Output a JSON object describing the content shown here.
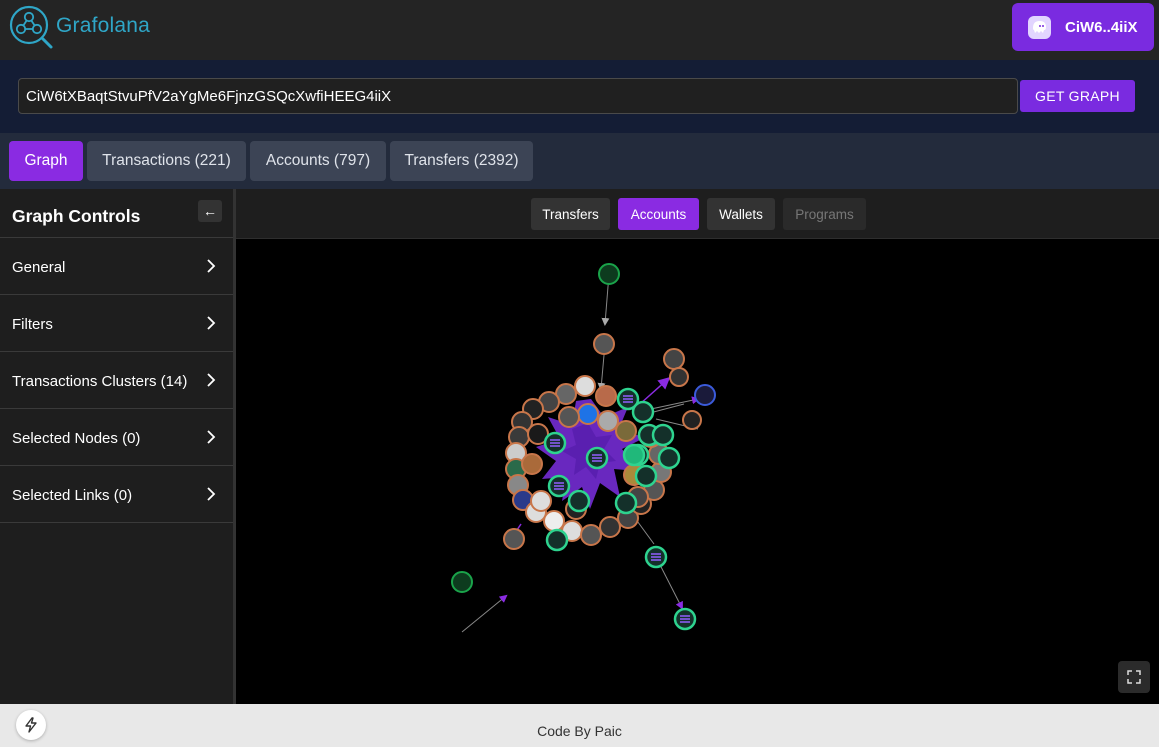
{
  "app": {
    "name": "Grafolana"
  },
  "wallet": {
    "label": "CiW6..4iiX"
  },
  "search": {
    "value": "CiW6tXBaqtStvuPfV2aYgMe6FjnzGSQcXwfiHEEG4iiX",
    "button_label": "GET GRAPH"
  },
  "tabs": [
    {
      "label": "Graph",
      "active": true
    },
    {
      "label": "Transactions (221)",
      "active": false
    },
    {
      "label": "Accounts (797)",
      "active": false
    },
    {
      "label": "Transfers (2392)",
      "active": false
    }
  ],
  "sidebar": {
    "title": "Graph Controls",
    "collapse_label": "←",
    "items": [
      {
        "label": "General"
      },
      {
        "label": "Filters"
      },
      {
        "label": "Transactions Clusters (14)"
      },
      {
        "label": "Selected Nodes (0)"
      },
      {
        "label": "Selected Links (0)"
      }
    ]
  },
  "graph_toolbar": [
    {
      "label": "Transfers",
      "state": "normal"
    },
    {
      "label": "Accounts",
      "state": "active"
    },
    {
      "label": "Wallets",
      "state": "normal"
    },
    {
      "label": "Programs",
      "state": "disabled"
    }
  ],
  "colors": {
    "accent": "#8a2be2",
    "node_border_orange": "#c8764a",
    "node_border_green": "#2ed38f",
    "edge_purple": "#8a2be2",
    "canvas_bg": "#000000"
  },
  "footer": {
    "text": "Code By Paic"
  }
}
